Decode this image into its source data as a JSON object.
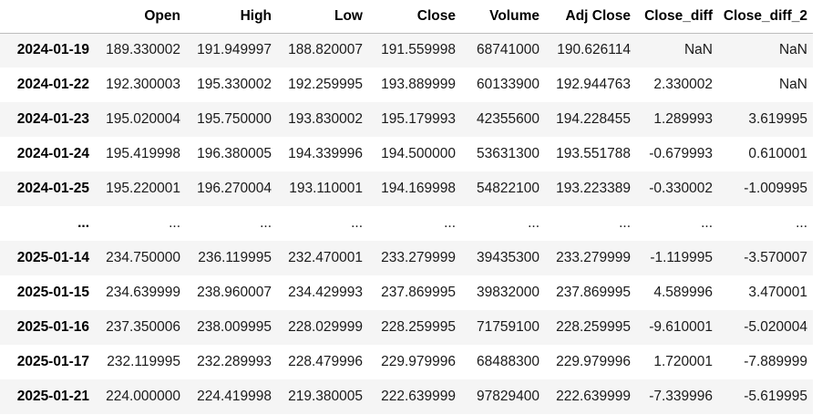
{
  "table": {
    "columns": [
      "",
      "Open",
      "High",
      "Low",
      "Close",
      "Volume",
      "Adj Close",
      "Close_diff",
      "Close_diff_2"
    ],
    "rows": [
      [
        "2024-01-19",
        "189.330002",
        "191.949997",
        "188.820007",
        "191.559998",
        "68741000",
        "190.626114",
        "NaN",
        "NaN"
      ],
      [
        "2024-01-22",
        "192.300003",
        "195.330002",
        "192.259995",
        "193.889999",
        "60133900",
        "192.944763",
        "2.330002",
        "NaN"
      ],
      [
        "2024-01-23",
        "195.020004",
        "195.750000",
        "193.830002",
        "195.179993",
        "42355600",
        "194.228455",
        "1.289993",
        "3.619995"
      ],
      [
        "2024-01-24",
        "195.419998",
        "196.380005",
        "194.339996",
        "194.500000",
        "53631300",
        "193.551788",
        "-0.679993",
        "0.610001"
      ],
      [
        "2024-01-25",
        "195.220001",
        "196.270004",
        "193.110001",
        "194.169998",
        "54822100",
        "193.223389",
        "-0.330002",
        "-1.009995"
      ],
      [
        "...",
        "...",
        "...",
        "...",
        "...",
        "...",
        "...",
        "...",
        "..."
      ],
      [
        "2025-01-14",
        "234.750000",
        "236.119995",
        "232.470001",
        "233.279999",
        "39435300",
        "233.279999",
        "-1.119995",
        "-3.570007"
      ],
      [
        "2025-01-15",
        "234.639999",
        "238.960007",
        "234.429993",
        "237.869995",
        "39832000",
        "237.869995",
        "4.589996",
        "3.470001"
      ],
      [
        "2025-01-16",
        "237.350006",
        "238.009995",
        "228.029999",
        "228.259995",
        "71759100",
        "228.259995",
        "-9.610001",
        "-5.020004"
      ],
      [
        "2025-01-17",
        "232.119995",
        "232.289993",
        "228.479996",
        "229.979996",
        "68488300",
        "229.979996",
        "1.720001",
        "-7.889999"
      ],
      [
        "2025-01-21",
        "224.000000",
        "224.419998",
        "219.380005",
        "222.639999",
        "97829400",
        "222.639999",
        "-7.339996",
        "-5.619995"
      ]
    ]
  }
}
